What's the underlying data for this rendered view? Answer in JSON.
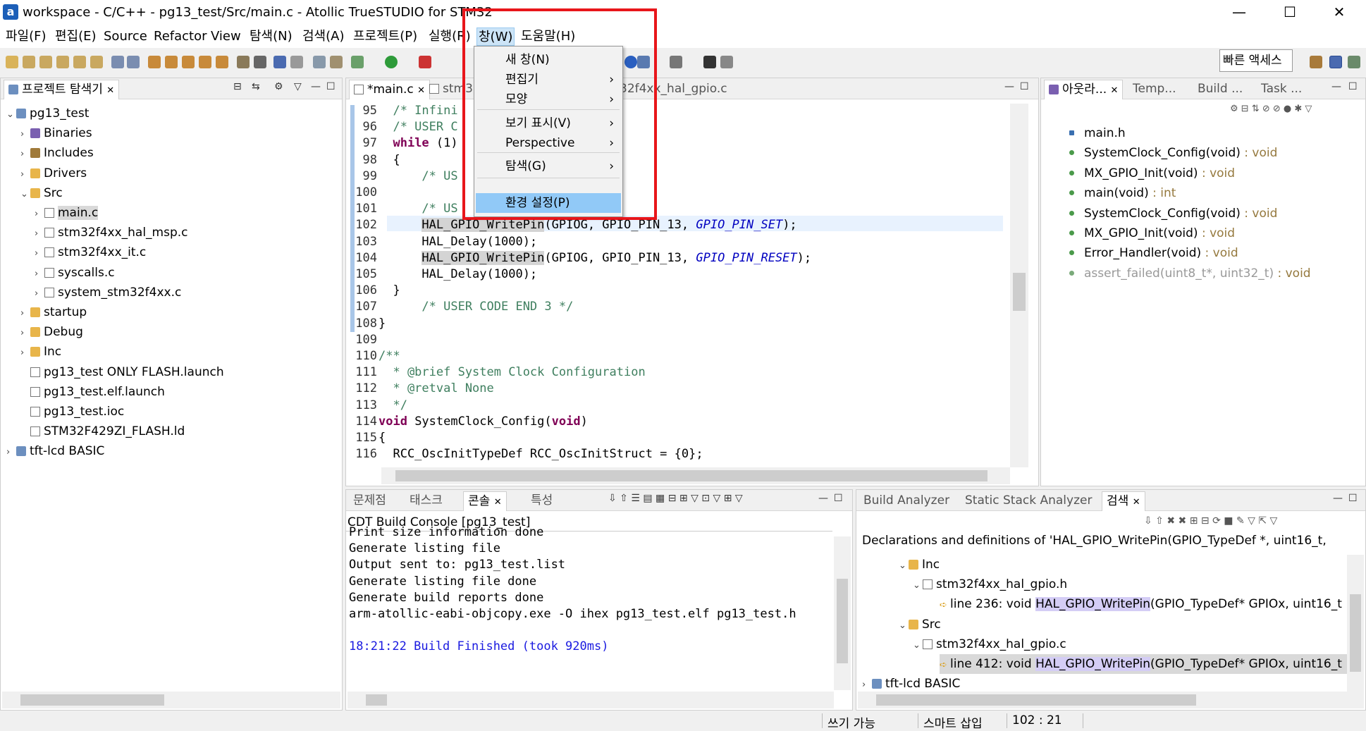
{
  "window": {
    "title": "workspace - C/C++ - pg13_test/Src/main.c - Atollic TrueSTUDIO for STM32",
    "minimize": "—",
    "maximize": "☐",
    "close": "✕"
  },
  "menu": [
    "파일(F)",
    "편집(E)",
    "Source",
    "Refactor",
    "View",
    "탐색(N)",
    "검색(A)",
    "프로젝트(P)",
    "실행(R)",
    "창(W)",
    "도움말(H)"
  ],
  "quick_access": "빠른 액세스",
  "dropdown": {
    "items": [
      {
        "label": "새 창(N)",
        "arrow": ""
      },
      {
        "label": "편집기",
        "arrow": "›"
      },
      {
        "label": "모양",
        "arrow": "›"
      },
      {
        "label": "보기 표시(V)",
        "arrow": "›"
      },
      {
        "label": "Perspective",
        "arrow": "›"
      },
      {
        "label": "탐색(G)",
        "arrow": "›"
      },
      {
        "label": "환경 설정(P)",
        "arrow": ""
      }
    ]
  },
  "explorer": {
    "tab": "프로젝트 탐색기",
    "rows": [
      {
        "label": "pg13_test",
        "tw": "⌄",
        "icon": "proj"
      },
      {
        "label": "Binaries",
        "tw": "›",
        "icon": "bin"
      },
      {
        "label": "Includes",
        "tw": "›",
        "icon": "inc"
      },
      {
        "label": "Drivers",
        "tw": "›",
        "icon": "folder"
      },
      {
        "label": "Src",
        "tw": "⌄",
        "icon": "folder"
      },
      {
        "label": "main.c",
        "tw": "›",
        "icon": "file"
      },
      {
        "label": "stm32f4xx_hal_msp.c",
        "tw": "›",
        "icon": "file"
      },
      {
        "label": "stm32f4xx_it.c",
        "tw": "›",
        "icon": "file"
      },
      {
        "label": "syscalls.c",
        "tw": "›",
        "icon": "file"
      },
      {
        "label": "system_stm32f4xx.c",
        "tw": "›",
        "icon": "file"
      },
      {
        "label": "startup",
        "tw": "›",
        "icon": "folder"
      },
      {
        "label": "Debug",
        "tw": "›",
        "icon": "folder"
      },
      {
        "label": "Inc",
        "tw": "›",
        "icon": "folder"
      },
      {
        "label": "pg13_test ONLY FLASH.launch",
        "tw": "",
        "icon": "file"
      },
      {
        "label": "pg13_test.elf.launch",
        "tw": "",
        "icon": "file"
      },
      {
        "label": "pg13_test.ioc",
        "tw": "",
        "icon": "file"
      },
      {
        "label": "STM32F429ZI_FLASH.ld",
        "tw": "",
        "icon": "file"
      },
      {
        "label": "tft-lcd BASIC",
        "tw": "›",
        "icon": "proj"
      }
    ]
  },
  "editor": {
    "tabs": [
      "*main.c",
      "stm32",
      "32f4xx_hal_gpio.c"
    ],
    "lines": [
      {
        "n": "95",
        "t": "  /* Infini"
      },
      {
        "n": "96",
        "t": "  /* USER C"
      },
      {
        "n": "97",
        "t": "  while (1)"
      },
      {
        "n": "98",
        "t": "  {"
      },
      {
        "n": "99",
        "t": "      /* US                  */"
      },
      {
        "n": "100",
        "t": ""
      },
      {
        "n": "101",
        "t": "      /* US"
      },
      {
        "n": "102",
        "t": "      HAL_GPIO_WritePin(GPIOG, GPIO_PIN_13, GPIO_PIN_SET);"
      },
      {
        "n": "103",
        "t": "      HAL_Delay(1000);"
      },
      {
        "n": "104",
        "t": "      HAL_GPIO_WritePin(GPIOG, GPIO_PIN_13, GPIO_PIN_RESET);"
      },
      {
        "n": "105",
        "t": "      HAL_Delay(1000);"
      },
      {
        "n": "106",
        "t": "  }"
      },
      {
        "n": "107",
        "t": "      /* USER CODE END 3 */"
      },
      {
        "n": "108",
        "t": "}"
      },
      {
        "n": "109",
        "t": ""
      },
      {
        "n": "110",
        "t": "/**"
      },
      {
        "n": "111",
        "t": "  * @brief System Clock Configuration"
      },
      {
        "n": "112",
        "t": "  * @retval None"
      },
      {
        "n": "113",
        "t": "  */"
      },
      {
        "n": "114",
        "t": "void SystemClock_Config(void)"
      },
      {
        "n": "115",
        "t": "{"
      },
      {
        "n": "116",
        "t": "  RCC_OscInitTypeDef RCC_OscInitStruct = {0};"
      }
    ]
  },
  "outline": {
    "tabs": [
      "아웃라...",
      "Temp...",
      "Build ...",
      "Task ..."
    ],
    "rows": [
      {
        "name": "main.h",
        "type": ""
      },
      {
        "name": "SystemClock_Config(void)",
        "type": " : void"
      },
      {
        "name": "MX_GPIO_Init(void)",
        "type": " : void"
      },
      {
        "name": "main(void)",
        "type": " : int"
      },
      {
        "name": "SystemClock_Config(void)",
        "type": " : void"
      },
      {
        "name": "MX_GPIO_Init(void)",
        "type": " : void"
      },
      {
        "name": "Error_Handler(void)",
        "type": " : void"
      },
      {
        "name": "assert_failed(uint8_t*, uint32_t)",
        "type": " : void"
      }
    ]
  },
  "console": {
    "tabs": [
      "문제점",
      "태스크",
      "콘솔",
      "특성"
    ],
    "header": "CDT Build Console [pg13_test]",
    "lines": [
      "Print size information done",
      "Generate listing file",
      "Output sent to: pg13_test.list",
      "Generate listing file done",
      "Generate build reports done",
      "arm-atollic-eabi-objcopy.exe -O ihex pg13_test.elf pg13_test.h",
      "",
      "18:21:22 Build Finished (took 920ms)"
    ]
  },
  "search": {
    "tabs": [
      "Build Analyzer",
      "Static Stack Analyzer",
      "검색"
    ],
    "header": "Declarations and definitions of 'HAL_GPIO_WritePin(GPIO_TypeDef *, uint16_t,",
    "rows": [
      {
        "label": "Inc",
        "tw": "⌄"
      },
      {
        "label": "stm32f4xx_hal_gpio.h",
        "tw": "⌄"
      },
      {
        "pre": "line 236:  void ",
        "match": "HAL_GPIO_WritePin",
        "post": "(GPIO_TypeDef* GPIOx, uint16_t"
      },
      {
        "label": "Src",
        "tw": "⌄"
      },
      {
        "label": "stm32f4xx_hal_gpio.c",
        "tw": "⌄"
      },
      {
        "pre": "line 412:  void ",
        "match": "HAL_GPIO_WritePin",
        "post": "(GPIO_TypeDef* GPIOx, uint16_t"
      },
      {
        "label": "tft-lcd BASIC",
        "tw": "›"
      }
    ]
  },
  "status": {
    "writable": "쓰기 가능",
    "insert": "스마트 삽입",
    "position": "102 : 21"
  },
  "colors": {
    "menu_highlight": "#cce4f7",
    "selection": "#91c9f7",
    "annotation": "#e8161b",
    "keyword": "#7f0055",
    "comment": "#3f7f5f",
    "constant": "#0000c0"
  }
}
